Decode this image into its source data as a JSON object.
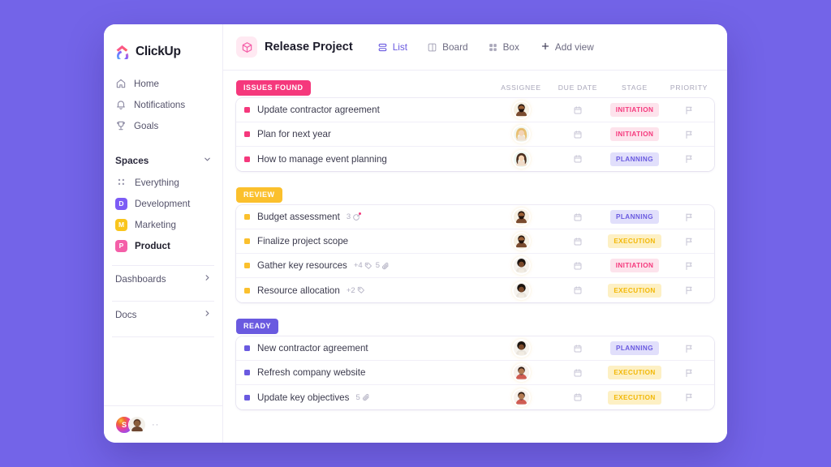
{
  "theme": {
    "page_background": "#7364e8",
    "accent_purple": "#6a5ae0",
    "pink": "#f5387c",
    "amber": "#fbc02d"
  },
  "sidebar": {
    "brand": "ClickUp",
    "nav": [
      {
        "label": "Home",
        "icon": "home-icon"
      },
      {
        "label": "Notifications",
        "icon": "bell-icon"
      },
      {
        "label": "Goals",
        "icon": "trophy-icon"
      }
    ],
    "spaces_header": "Spaces",
    "spaces": [
      {
        "label": "Everything",
        "initial": "",
        "color": "",
        "icon": "grid-dots-icon",
        "active": false
      },
      {
        "label": "Development",
        "initial": "D",
        "color": "#7c5cf5",
        "active": false
      },
      {
        "label": "Marketing",
        "initial": "M",
        "color": "#f9c51d",
        "active": false
      },
      {
        "label": "Product",
        "initial": "P",
        "color": "#f45fa8",
        "active": true
      }
    ],
    "links": [
      {
        "label": "Dashboards",
        "icon": "chevron-right-icon"
      },
      {
        "label": "Docs",
        "icon": "chevron-right-icon"
      }
    ],
    "footer": {
      "avatar_initial": "S",
      "more": "··"
    }
  },
  "topbar": {
    "project_title": "Release Project",
    "project_icon": "box-icon",
    "tabs": [
      {
        "label": "List",
        "icon": "list-icon",
        "active": true
      },
      {
        "label": "Board",
        "icon": "board-icon",
        "active": false
      },
      {
        "label": "Box",
        "icon": "box-grid-icon",
        "active": false
      }
    ],
    "add_view": "Add view"
  },
  "columns": {
    "assignee": "ASSIGNEE",
    "due_date": "DUE DATE",
    "stage": "STAGE",
    "priority": "PRIORITY"
  },
  "stage_styles": {
    "INITIATION": {
      "bg": "#fde3ec",
      "fg": "#f5387c"
    },
    "PLANNING": {
      "bg": "#e1dffb",
      "fg": "#6a5ae0"
    },
    "EXECUTION": {
      "bg": "#fdf0c4",
      "fg": "#f2b705"
    }
  },
  "groups": [
    {
      "name": "ISSUES FOUND",
      "badge_bg": "#f5387c",
      "dot_color": "#f5387c",
      "tasks": [
        {
          "name": "Update contractor agreement",
          "stage": "INITIATION",
          "avatar": "male-beard",
          "meta": []
        },
        {
          "name": "Plan for next year",
          "stage": "INITIATION",
          "avatar": "female-blonde",
          "meta": []
        },
        {
          "name": "How to manage event planning",
          "stage": "PLANNING",
          "avatar": "female-brunette",
          "meta": []
        }
      ]
    },
    {
      "name": "REVIEW",
      "badge_bg": "#fbc02d",
      "dot_color": "#fbc02d",
      "tasks": [
        {
          "name": "Budget assessment",
          "stage": "PLANNING",
          "avatar": "male-beard",
          "meta": [
            {
              "count": "3",
              "icon": "subtask-icon",
              "alert": true
            }
          ]
        },
        {
          "name": "Finalize project scope",
          "stage": "EXECUTION",
          "avatar": "male-beard",
          "meta": []
        },
        {
          "name": "Gather key resources",
          "stage": "INITIATION",
          "avatar": "male-afro",
          "meta": [
            {
              "count": "+4",
              "icon": "tag-icon",
              "alert": false
            },
            {
              "count": "5",
              "icon": "paperclip-icon",
              "alert": false
            }
          ]
        },
        {
          "name": "Resource allocation",
          "stage": "EXECUTION",
          "avatar": "male-afro",
          "meta": [
            {
              "count": "+2",
              "icon": "tag-icon",
              "alert": false
            }
          ]
        }
      ]
    },
    {
      "name": "READY",
      "badge_bg": "#6a5ae0",
      "dot_color": "#6a5ae0",
      "tasks": [
        {
          "name": "New contractor agreement",
          "stage": "PLANNING",
          "avatar": "male-afro",
          "meta": []
        },
        {
          "name": "Refresh company website",
          "stage": "EXECUTION",
          "avatar": "male-short",
          "meta": []
        },
        {
          "name": "Update key objectives",
          "stage": "EXECUTION",
          "avatar": "male-short",
          "meta": [
            {
              "count": "5",
              "icon": "paperclip-icon",
              "alert": false
            }
          ]
        }
      ]
    }
  ]
}
